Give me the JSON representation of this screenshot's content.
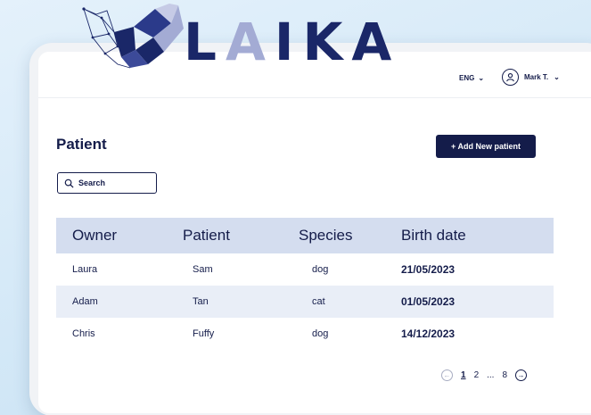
{
  "logo": {
    "letters": [
      "L",
      "A",
      "I",
      "K",
      "A"
    ]
  },
  "header": {
    "language": "ENG",
    "user_name": "Mark T."
  },
  "page": {
    "title": "Patient",
    "add_button_label": "+ Add New patient",
    "search_placeholder": "Search"
  },
  "table": {
    "columns": [
      "Owner",
      "Patient",
      "Species",
      "Birth date"
    ],
    "rows": [
      {
        "owner": "Laura",
        "patient": "Sam",
        "species": "dog",
        "birth_date": "21/05/2023"
      },
      {
        "owner": "Adam",
        "patient": "Tan",
        "species": "cat",
        "birth_date": "01/05/2023"
      },
      {
        "owner": "Chris",
        "patient": "Fuffy",
        "species": "dog",
        "birth_date": "14/12/2023"
      }
    ]
  },
  "pagination": {
    "pages": [
      "1",
      "2",
      "...",
      "8"
    ],
    "current": "1"
  },
  "colors": {
    "primary": "#141c4a",
    "logo_dark": "#1a2768",
    "logo_light": "#a3abd4",
    "header_row": "#d4ddef",
    "alt_row": "#e9eef7",
    "background": "#d3e8f7"
  },
  "icons": {
    "logo_mark": "dog-head-geometric-icon",
    "lang_chevron": "chevron-down-icon",
    "user": "user-circle-icon",
    "user_chevron": "chevron-down-icon",
    "search": "search-icon",
    "prev": "arrow-left-circle-icon",
    "next": "arrow-right-circle-icon"
  }
}
